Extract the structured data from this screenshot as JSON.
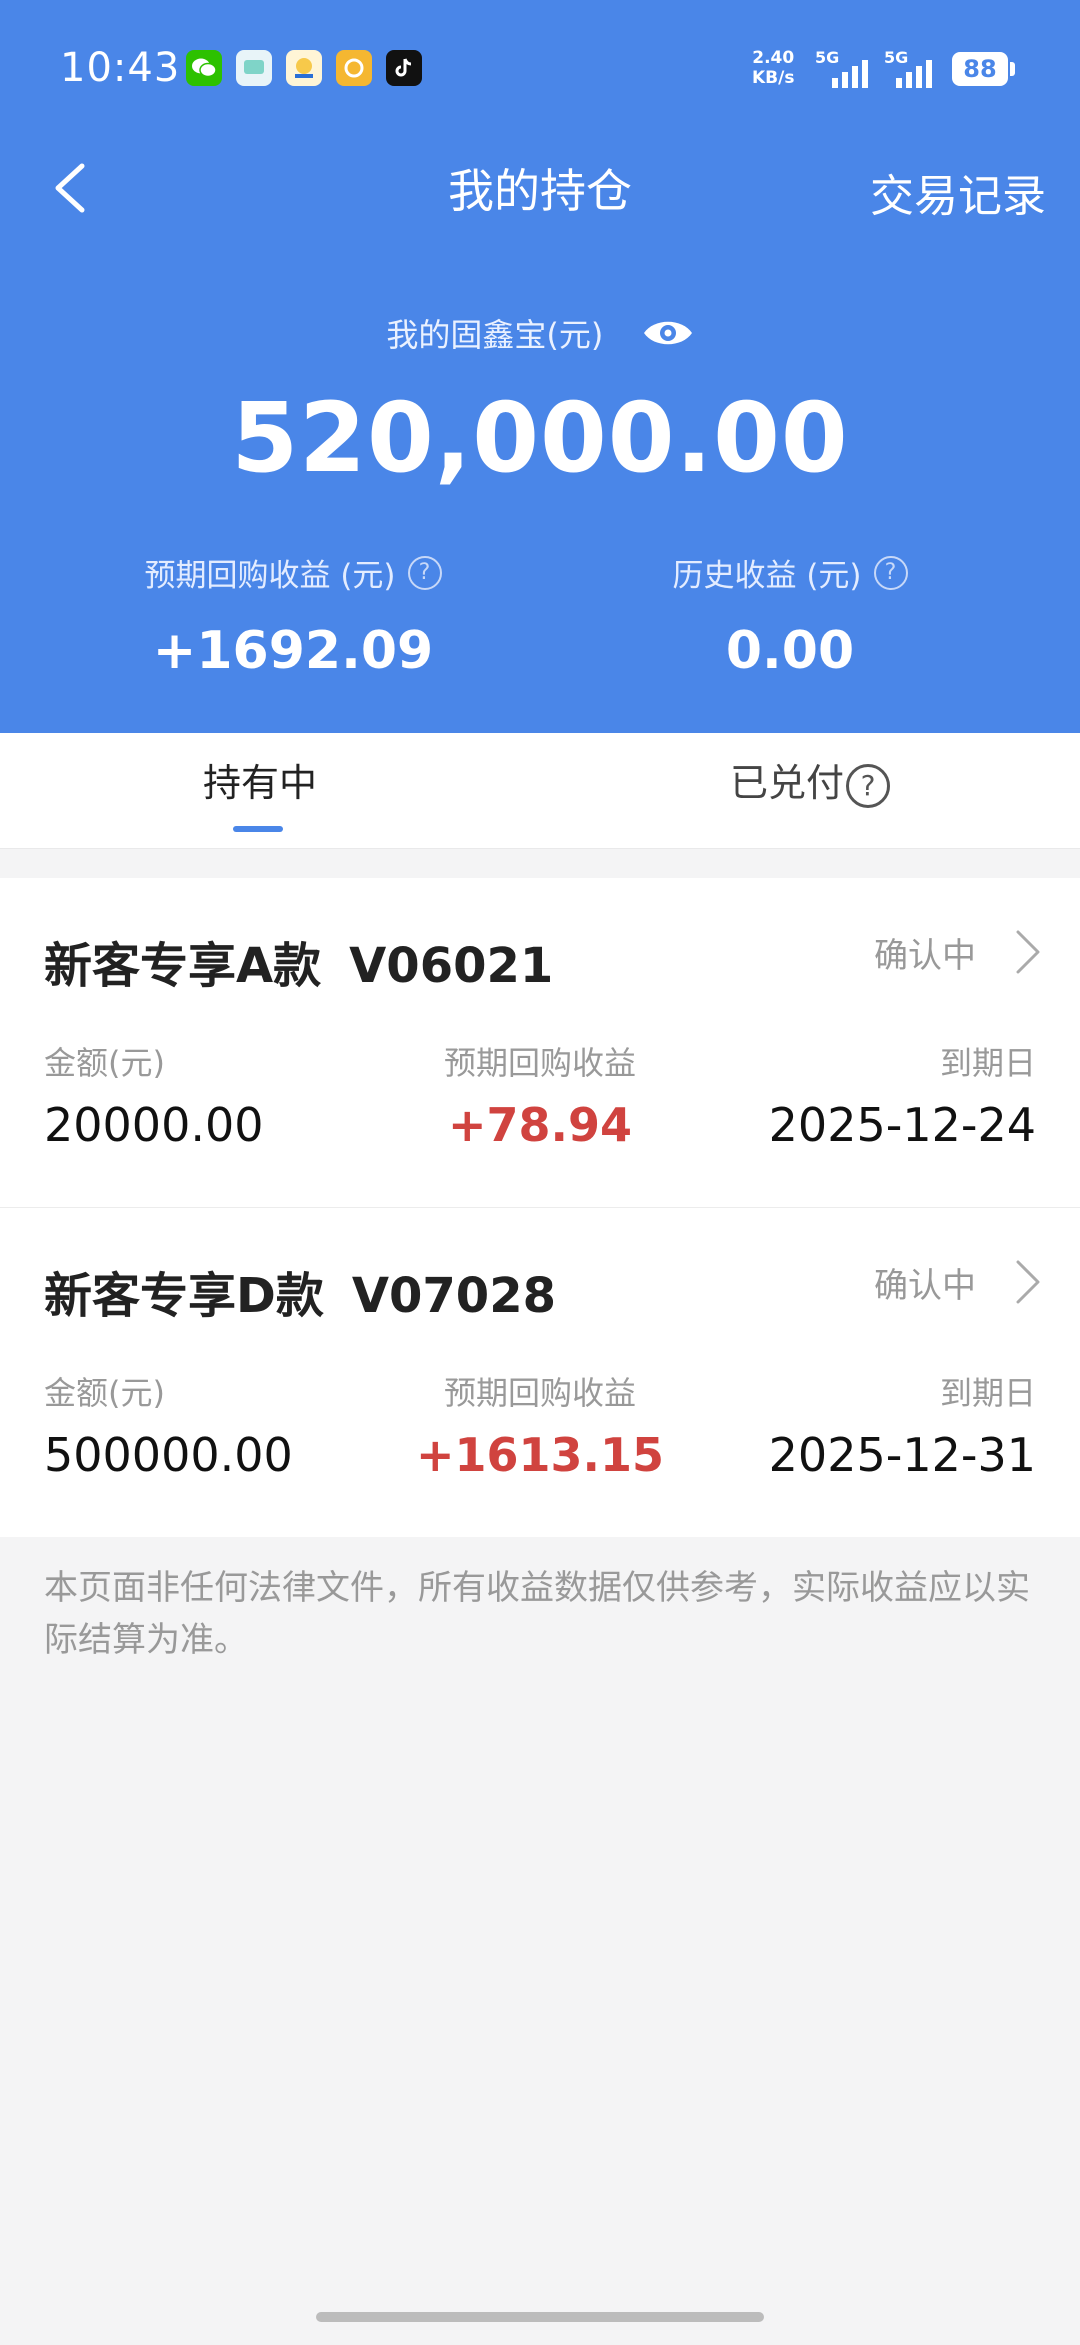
{
  "status_bar": {
    "time": "10:43",
    "net_speed_value": "2.40",
    "net_speed_unit": "KB/s",
    "signal_1": "5G",
    "signal_2": "5G",
    "battery": "88",
    "app_icons": [
      "wechat-icon",
      "messages-icon",
      "eastmoney-icon",
      "yellow-app-icon",
      "tiktok-icon"
    ]
  },
  "nav": {
    "title": "我的持仓",
    "right_action": "交易记录"
  },
  "summary": {
    "label": "我的固鑫宝(元)",
    "amount": "520,000.00",
    "stats": [
      {
        "label": "预期回购收益 (元)",
        "value": "+1692.09"
      },
      {
        "label": "历史收益 (元)",
        "value": "0.00"
      }
    ]
  },
  "tabs": [
    {
      "label": "持有中",
      "active": true
    },
    {
      "label": "已兑付",
      "active": false
    }
  ],
  "columns": {
    "amount": "金额(元)",
    "expected": "预期回购收益",
    "maturity": "到期日"
  },
  "holdings": [
    {
      "name": "新客专享A款",
      "code": "V06021",
      "status": "确认中",
      "amount": "20000.00",
      "expected": "+78.94",
      "maturity": "2025-12-24"
    },
    {
      "name": "新客专享D款",
      "code": "V07028",
      "status": "确认中",
      "amount": "500000.00",
      "expected": "+1613.15",
      "maturity": "2025-12-31"
    }
  ],
  "disclaimer": "本页面非任何法律文件，所有收益数据仅供参考，实际收益应以实际结算为准。",
  "colors": {
    "header_blue": "#4a86e8",
    "profit_red": "#d0433f",
    "muted_gray": "#999999"
  }
}
